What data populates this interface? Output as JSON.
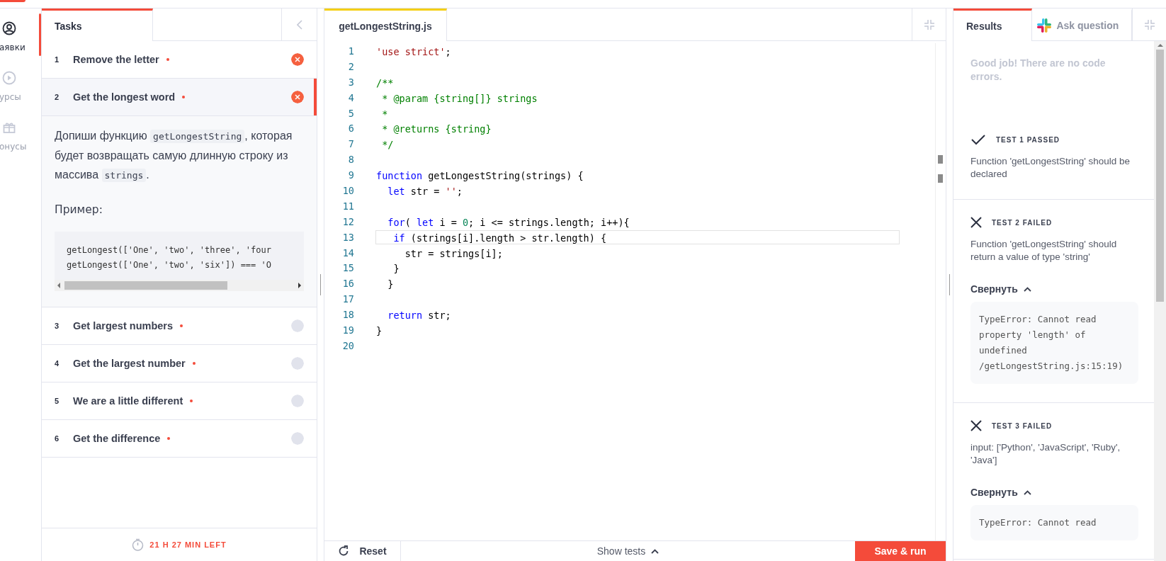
{
  "nav": {
    "items": [
      {
        "label": "аявки",
        "kind": "user",
        "selected": true
      },
      {
        "label": "урсы",
        "kind": "play",
        "selected": false
      },
      {
        "label": "онусы",
        "kind": "gift",
        "selected": false
      }
    ]
  },
  "tasks": {
    "title": "Tasks",
    "items": [
      {
        "number": "1",
        "title": "Remove the letter",
        "kind": "failed",
        "selected": false
      },
      {
        "number": "2",
        "title": "Get the longest word",
        "kind": "failed",
        "selected": true
      },
      {
        "number": "3",
        "title": "Get largest numbers",
        "kind": "pending",
        "selected": false
      },
      {
        "number": "4",
        "title": "Get the largest number",
        "kind": "pending",
        "selected": false
      },
      {
        "number": "5",
        "title": "We are a little different",
        "kind": "pending",
        "selected": false
      },
      {
        "number": "6",
        "title": "Get the difference",
        "kind": "pending",
        "selected": false
      }
    ],
    "description": [
      {
        "kind": "text",
        "text": "Допиши функцию "
      },
      {
        "kind": "code",
        "text": "getLongestString"
      },
      {
        "kind": "text",
        "text": ", которая будет возвращать самую длинную строку из массива "
      },
      {
        "kind": "code",
        "text": "strings"
      },
      {
        "kind": "text",
        "text": "."
      }
    ],
    "example_label": "Пример:",
    "example_code": [
      "getLongest(['One', 'two', 'three', 'four",
      "getLongest(['One', 'two', 'six']) === 'O"
    ],
    "timer": "21 H 27 MIN LEFT"
  },
  "editor": {
    "file_tab": "getLongestString.js",
    "lines": [
      {
        "n": "1",
        "current": false,
        "tokens": [
          {
            "kind": "str",
            "text": "'use strict'"
          },
          {
            "kind": "plain",
            "text": ";"
          }
        ]
      },
      {
        "n": "2",
        "current": false
      },
      {
        "n": "3",
        "current": false,
        "tokens": [
          {
            "kind": "comment",
            "text": "/**"
          }
        ]
      },
      {
        "n": "4",
        "current": false,
        "tokens": [
          {
            "kind": "comment",
            "text": " * @param {string[]} strings"
          }
        ]
      },
      {
        "n": "5",
        "current": false,
        "tokens": [
          {
            "kind": "comment",
            "text": " *"
          }
        ]
      },
      {
        "n": "6",
        "current": false,
        "tokens": [
          {
            "kind": "comment",
            "text": " * @returns {string}"
          }
        ]
      },
      {
        "n": "7",
        "current": false,
        "tokens": [
          {
            "kind": "comment",
            "text": " */"
          }
        ]
      },
      {
        "n": "8",
        "current": false
      },
      {
        "n": "9",
        "current": false,
        "tokens": [
          {
            "kind": "kw",
            "text": "function"
          },
          {
            "kind": "plain",
            "text": " getLongestString(strings) {"
          }
        ]
      },
      {
        "n": "10",
        "current": false,
        "tokens": [
          {
            "kind": "kw",
            "text": "  let"
          },
          {
            "kind": "plain",
            "text": " str = "
          },
          {
            "kind": "str",
            "text": "''"
          },
          {
            "kind": "plain",
            "text": ";"
          }
        ]
      },
      {
        "n": "11",
        "current": false
      },
      {
        "n": "12",
        "current": false,
        "tokens": [
          {
            "kind": "kw",
            "text": "  for"
          },
          {
            "kind": "plain",
            "text": "( "
          },
          {
            "kind": "kw",
            "text": "let"
          },
          {
            "kind": "plain",
            "text": " i = "
          },
          {
            "kind": "num",
            "text": "0"
          },
          {
            "kind": "plain",
            "text": "; i <= strings.length; i++){"
          }
        ]
      },
      {
        "n": "13",
        "current": true,
        "tokens": [
          {
            "kind": "kw",
            "text": "   if"
          },
          {
            "kind": "plain",
            "text": " (strings[i].length > str.length) {"
          }
        ]
      },
      {
        "n": "14",
        "current": false,
        "tokens": [
          {
            "kind": "plain",
            "text": "     str = strings[i];"
          }
        ]
      },
      {
        "n": "15",
        "current": false,
        "tokens": [
          {
            "kind": "plain",
            "text": "   }"
          }
        ]
      },
      {
        "n": "16",
        "current": false,
        "tokens": [
          {
            "kind": "plain",
            "text": "  }"
          }
        ]
      },
      {
        "n": "17",
        "current": false
      },
      {
        "n": "18",
        "current": false,
        "tokens": [
          {
            "kind": "kw",
            "text": "  return"
          },
          {
            "kind": "plain",
            "text": " str;"
          }
        ]
      },
      {
        "n": "19",
        "current": false,
        "tokens": [
          {
            "kind": "plain",
            "text": "}"
          }
        ]
      },
      {
        "n": "20",
        "current": false
      }
    ],
    "reset": "Reset",
    "show_tests": "Show tests",
    "save_run": "Save & run"
  },
  "results": {
    "tabs": [
      {
        "label": "Results",
        "selected": true
      },
      {
        "label": "Ask question",
        "selected": false
      }
    ],
    "message": "Good job! There are no code errors.",
    "tests": [
      {
        "kind": "passed",
        "title": "TEST 1 PASSED",
        "description": "Function 'getLongestString' should be declared"
      },
      {
        "kind": "failed",
        "title": "TEST 2 FAILED",
        "description": "Function 'getLongestString' should return a value of type 'string'",
        "collapse": "Свернуть",
        "error": "TypeError: Cannot read property 'length' of undefined /getLongestString.js:15:19)"
      },
      {
        "kind": "failed",
        "title": "TEST 3 FAILED",
        "description": "input: ['Python', 'JavaScript', 'Ruby', 'Java']",
        "collapse": "Свернуть",
        "error": "TypeError: Cannot read"
      }
    ]
  }
}
